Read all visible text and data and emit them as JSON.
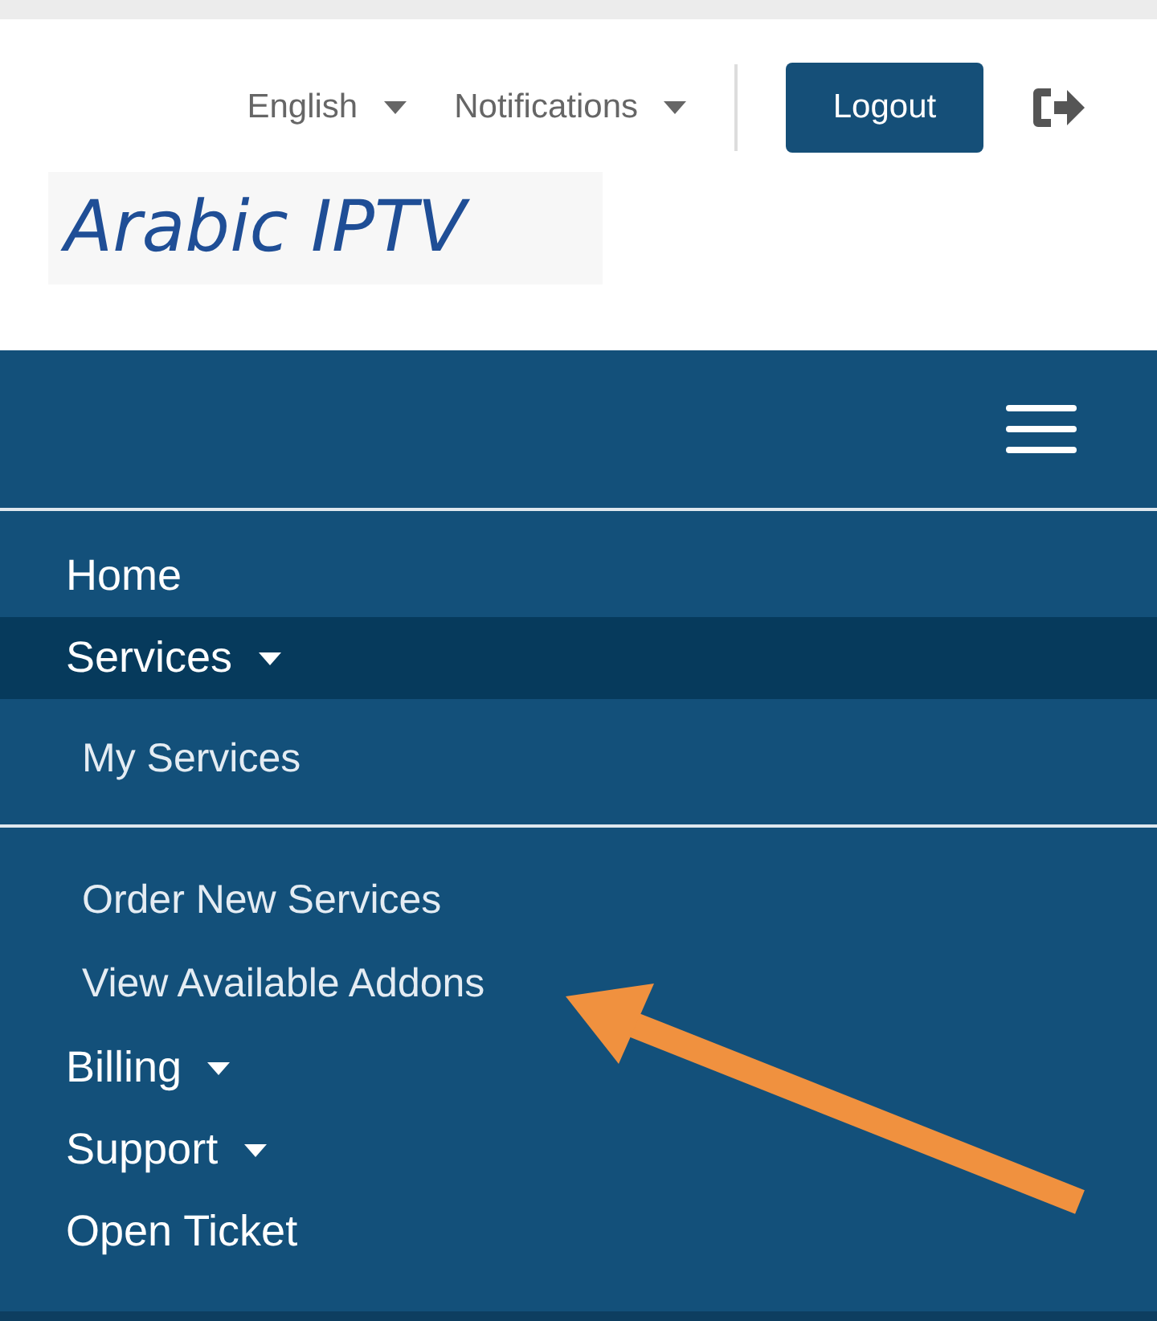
{
  "header": {
    "language": "English",
    "notifications": "Notifications",
    "logout": "Logout",
    "logo": "Arabic IPTV"
  },
  "nav": [
    {
      "label": "Home",
      "kind": "link",
      "selected": false
    },
    {
      "label": "Services",
      "kind": "dropdown",
      "selected": true,
      "children": [
        {
          "label": "My Services",
          "divider_after": true
        },
        {
          "label": "Order New Services",
          "divider_after": false
        },
        {
          "label": "View Available Addons",
          "divider_after": false
        }
      ]
    },
    {
      "label": "Billing",
      "kind": "dropdown",
      "selected": false
    },
    {
      "label": "Support",
      "kind": "dropdown",
      "selected": false
    },
    {
      "label": "Open Ticket",
      "kind": "link",
      "selected": false
    }
  ]
}
